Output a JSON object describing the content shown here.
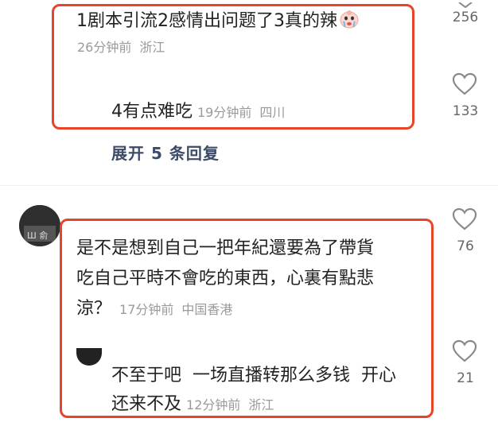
{
  "colors": {
    "highlight_border": "#e8442a",
    "meta_text": "#9a9a9a",
    "expand_text": "#3b4b68"
  },
  "comments": [
    {
      "text": "1剧本引流2感情出问题了3真的辣",
      "emoji": "crying-face-emoji",
      "time": "26分钟前",
      "location": "浙江",
      "likes": "256",
      "reply": {
        "text": "4有点难吃",
        "time": "19分钟前",
        "location": "四川",
        "likes": "133"
      },
      "expand_label": "展开 5 条回复"
    },
    {
      "text_line1": "是不是想到自己一把年紀還要為了帶貨",
      "text_line2": "吃自己平時不會吃的東西，心裏有點悲",
      "text_line3": "涼？",
      "time": "17分钟前",
      "location": "中国香港",
      "likes": "76",
      "reply": {
        "text_line1": "不至于吧  一场直播转那么多钱  开心",
        "text_line2": "还来不及",
        "time": "12分钟前",
        "location": "浙江",
        "likes": "21"
      }
    }
  ]
}
